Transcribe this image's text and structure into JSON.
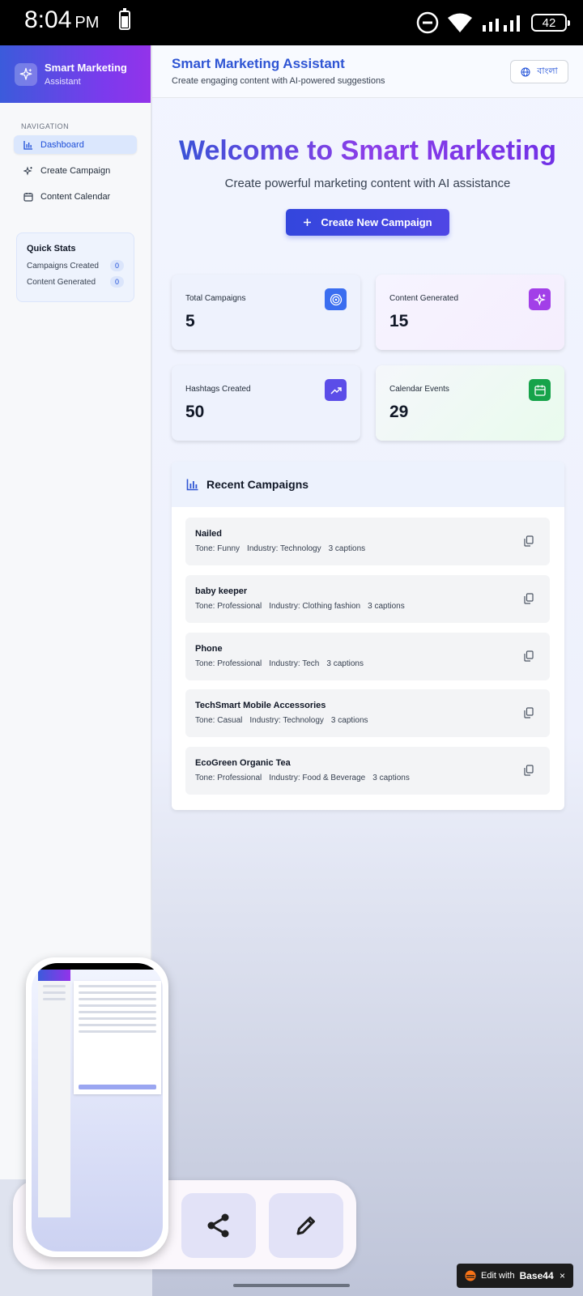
{
  "status_bar": {
    "time": "8:04",
    "ampm": "PM",
    "battery": "42"
  },
  "sidebar": {
    "brand_title": "Smart Marketing",
    "brand_subtitle": "Assistant",
    "nav_heading": "NAVIGATION",
    "items": [
      {
        "label": "Dashboard",
        "icon": "bar-chart-icon",
        "active": true
      },
      {
        "label": "Create Campaign",
        "icon": "sparkles-icon",
        "active": false
      },
      {
        "label": "Content Calendar",
        "icon": "calendar-icon",
        "active": false
      }
    ],
    "quick_stats": {
      "title": "Quick Stats",
      "rows": [
        {
          "label": "Campaigns Created",
          "value": "0"
        },
        {
          "label": "Content Generated",
          "value": "0"
        }
      ]
    }
  },
  "header": {
    "title": "Smart Marketing Assistant",
    "subtitle": "Create engaging content with AI-powered suggestions",
    "language_button": "বাংলা"
  },
  "hero": {
    "title_prefix": "Welcome to ",
    "title_highlight": "Smart Marketing",
    "subtitle": "Create powerful marketing content with AI assistance",
    "cta_label": "Create New Campaign"
  },
  "stats": [
    {
      "label": "Total Campaigns",
      "value": "5",
      "icon": "target-icon",
      "color": "#3b6ef0"
    },
    {
      "label": "Content Generated",
      "value": "15",
      "icon": "sparkles-icon",
      "color": "#a23fe8"
    },
    {
      "label": "Hashtags Created",
      "value": "50",
      "icon": "trending-up-icon",
      "color": "#5b4de8"
    },
    {
      "label": "Calendar Events",
      "value": "29",
      "icon": "calendar-icon",
      "color": "#16a34a"
    }
  ],
  "recent": {
    "title": "Recent Campaigns",
    "campaigns": [
      {
        "name": "Nailed",
        "tone": "Tone: Funny",
        "industry": "Industry: Technology",
        "captions": "3 captions"
      },
      {
        "name": "baby keeper",
        "tone": "Tone: Professional",
        "industry": "Industry: Clothing fashion",
        "captions": "3 captions"
      },
      {
        "name": "Phone",
        "tone": "Tone: Professional",
        "industry": "Industry: Tech",
        "captions": "3 captions"
      },
      {
        "name": "TechSmart Mobile Accessories",
        "tone": "Tone: Casual",
        "industry": "Industry: Technology",
        "captions": "3 captions"
      },
      {
        "name": "EcoGreen Organic Tea",
        "tone": "Tone: Professional",
        "industry": "Industry: Food & Beverage",
        "captions": "3 captions"
      }
    ]
  },
  "badge": {
    "prefix": "Edit with",
    "brand": "Base44",
    "close": "×"
  }
}
